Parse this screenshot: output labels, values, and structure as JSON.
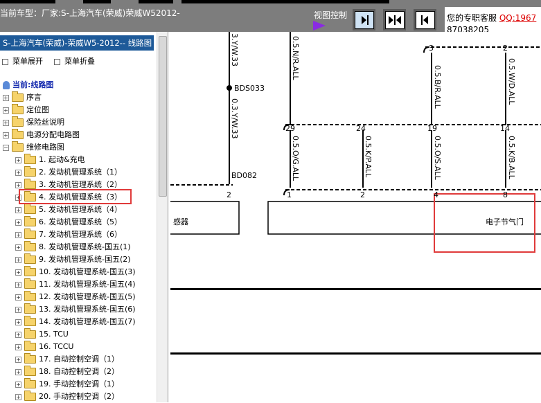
{
  "topbar": {
    "car_model": "当前车型：厂家:S-上海汽车(荣威)荣威W52012-",
    "view_control": "视图控制",
    "service_label": "您的专职客服",
    "service_qq": "QQ:1967",
    "service_number": "87038205",
    "buttons": [
      "next-page-icon",
      "fit-view-icon",
      "prev-page-icon"
    ]
  },
  "sidebar": {
    "header": "S-上海汽车(荣威)-荣威W5-2012-- 线路图",
    "expand_menu": "菜单展开",
    "collapse_menu": "菜单折叠",
    "current": "当前:线路图",
    "top_items": [
      "序言",
      "定位图",
      "保险丝说明",
      "电源分配电路图",
      "维修电路图"
    ],
    "sub_items": [
      "1. 起动&充电",
      "2. 发动机管理系统（1）",
      "3. 发动机管理系统（2）",
      "4. 发动机管理系统（3）",
      "5. 发动机管理系统（4）",
      "6. 发动机管理系统（5）",
      "7. 发动机管理系统（6）",
      "8. 发动机管理系统-国五(1)",
      "9. 发动机管理系统-国五(2)",
      "10. 发动机管理系统-国五(3)",
      "11. 发动机管理系统-国五(4)",
      "12. 发动机管理系统-国五(5)",
      "13. 发动机管理系统-国五(6)",
      "14. 发动机管理系统-国五(7)",
      "15. TCU",
      "16. TCCU",
      "17. 自动控制空调（1）",
      "18. 自动控制空调（2）",
      "19. 手动控制空调（1）",
      "20. 手动控制空调（2）"
    ],
    "selected_index": 3
  },
  "diagram": {
    "connector_labels": [
      "BDS033",
      "BD082"
    ],
    "wire_labels_top": [
      "3.Y/W.33",
      "0.5.N/R.ALL",
      "0.5.B/R.ALL",
      "0.5.W/D.ALL"
    ],
    "wire_labels_mid": [
      "0.3.Y/W.33",
      "0.5.O/G.ALL",
      "0.5.K/P.ALL",
      "0.5.O/S.ALL",
      "0.5.K/B.ALL"
    ],
    "top_pins": [
      "3",
      "2"
    ],
    "mid_pins": [
      "29",
      "24",
      "19",
      "14"
    ],
    "bottom_pins_left": [
      "2"
    ],
    "bottom_pins": [
      "1",
      "2",
      "4",
      "8"
    ],
    "component_left": "感器",
    "component_throttle": "电子节气门"
  },
  "colors": {
    "accent": "#1e5a99",
    "highlight": "#e03a3a",
    "topbar": "#7d7d7d"
  }
}
